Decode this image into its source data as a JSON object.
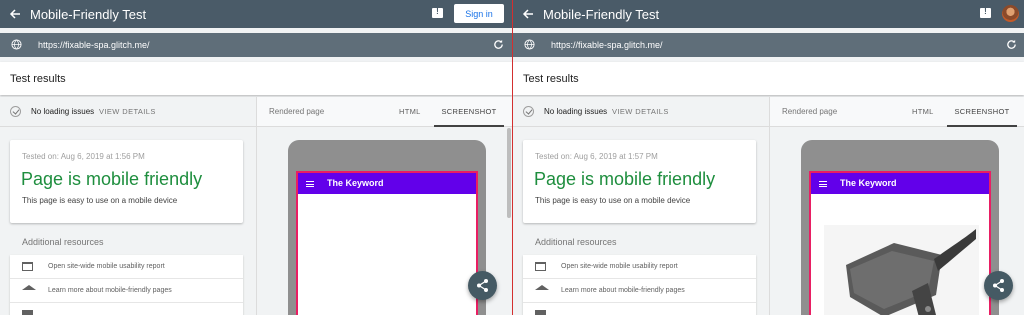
{
  "colors": {
    "topbar": "#4a5b68",
    "urlbar": "#5f6e79",
    "friendly": "#1e8e3e",
    "app_bar": "#6200ea",
    "screen_border": "#e91e63",
    "fab": "#455a64",
    "divider": "#d32f2f"
  },
  "left": {
    "app_title": "Mobile-Friendly Test",
    "signin_label": "Sign in",
    "url": "https://fixable-spa.glitch.me/",
    "results_title": "Test results",
    "status": {
      "text": "No loading issues",
      "link": "VIEW DETAILS"
    },
    "card": {
      "tested": "Tested on: Aug 6, 2019 at 1:56 PM",
      "headline": "Page is mobile friendly",
      "desc": "This page is easy to use on a mobile device"
    },
    "resources_title": "Additional resources",
    "resources": [
      {
        "icon": "report-icon",
        "label": "Open site-wide mobile usability report"
      },
      {
        "icon": "graduation-cap-icon",
        "label": "Learn more about mobile-friendly pages"
      },
      {
        "icon": "document-icon",
        "label": ""
      }
    ],
    "preview": {
      "label": "Rendered page",
      "tab_html": "HTML",
      "tab_screenshot": "SCREENSHOT",
      "app_title": "The Keyword"
    }
  },
  "right": {
    "app_title": "Mobile-Friendly Test",
    "url": "https://fixable-spa.glitch.me/",
    "results_title": "Test results",
    "status": {
      "text": "No loading issues",
      "link": "VIEW DETAILS"
    },
    "card": {
      "tested": "Tested on: Aug 6, 2019 at 1:57 PM",
      "headline": "Page is mobile friendly",
      "desc": "This page is easy to use on a mobile device"
    },
    "resources_title": "Additional resources",
    "resources": [
      {
        "icon": "report-icon",
        "label": "Open site-wide mobile usability report"
      },
      {
        "icon": "graduation-cap-icon",
        "label": "Learn more about mobile-friendly pages"
      },
      {
        "icon": "document-icon",
        "label": ""
      }
    ],
    "preview": {
      "label": "Rendered page",
      "tab_html": "HTML",
      "tab_screenshot": "SCREENSHOT",
      "app_title": "The Keyword"
    }
  }
}
